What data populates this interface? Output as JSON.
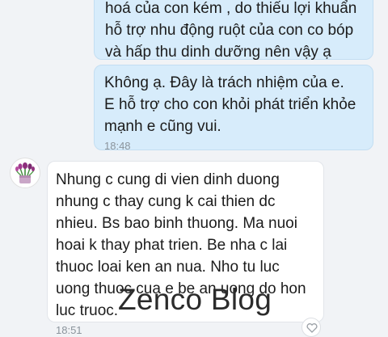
{
  "messages": [
    {
      "direction": "outgoing",
      "lines": [
        "hoá của con kém , do thiếu lợi khuẩn",
        "hỗ trợ nhu động ruột của con co bóp",
        "và hấp thu dinh dưỡng nên vậy ạ"
      ]
    },
    {
      "direction": "outgoing",
      "lines": [
        "Không ạ. Đây là trách nhiệm của e.",
        "E hỗ trợ cho con khỏi phát triển khỏe",
        "mạnh e cũng vui."
      ],
      "time": "18:48"
    },
    {
      "direction": "incoming",
      "lines": [
        "Nhung c cung di vien dinh duong",
        "nhung c thay cung k cai thien dc",
        "nhieu. Bs bao binh thuong. Ma nuoi",
        "hoai k thay phat trien. Be nha c lai",
        "thuoc loai ken an nua. Nho tu luc",
        "uong thuoc cua e be an uong do hon",
        "luc truoc."
      ],
      "time": "18:51"
    }
  ],
  "watermark": "Zenco Blog",
  "icons": {
    "avatar": "flower-bouquet-avatar",
    "reaction": "heart-icon"
  },
  "colors": {
    "outgoing_bubble": "#d7ecfb",
    "incoming_bubble": "#ffffff",
    "background": "#f1f3f6"
  }
}
